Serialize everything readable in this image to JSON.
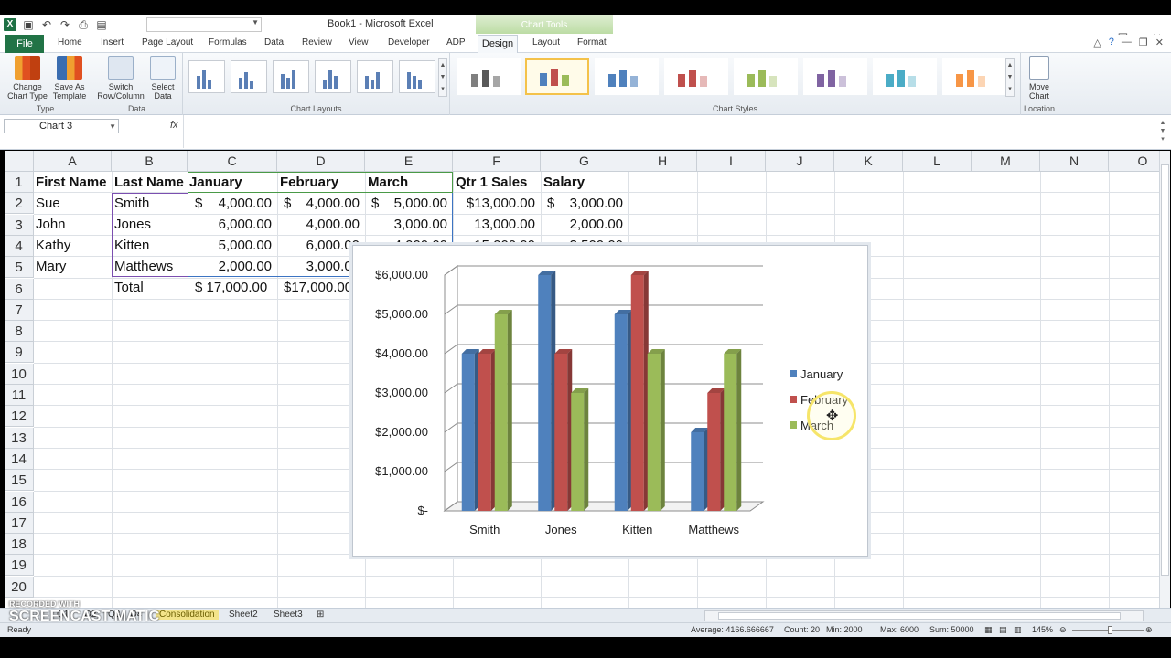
{
  "window": {
    "title": "Book1 - Microsoft Excel",
    "context_tab_group": "Chart Tools"
  },
  "tabs": [
    "File",
    "Home",
    "Insert",
    "Page Layout",
    "Formulas",
    "Data",
    "Review",
    "View",
    "Developer",
    "ADP",
    "Design",
    "Layout",
    "Format"
  ],
  "ribbon": {
    "type_group": {
      "label": "Type",
      "change_chart_type": "Change Chart Type",
      "save_as_template": "Save As Template"
    },
    "data_group": {
      "label": "Data",
      "switch_row_column": "Switch Row/Column",
      "select_data": "Select Data"
    },
    "chart_layouts_label": "Chart Layouts",
    "chart_styles_label": "Chart Styles",
    "location_group": {
      "label": "Location",
      "move_chart": "Move Chart"
    }
  },
  "formula_bar": {
    "name_box": "Chart 3",
    "fx": "fx",
    "content": ""
  },
  "columns": [
    "A",
    "B",
    "C",
    "D",
    "E",
    "F",
    "G",
    "H",
    "I",
    "J",
    "K",
    "L",
    "M",
    "N",
    "O"
  ],
  "rows": [
    "1",
    "2",
    "3",
    "4",
    "5",
    "6",
    "7",
    "8",
    "9",
    "10",
    "11",
    "12",
    "13",
    "14",
    "15",
    "16",
    "17",
    "18",
    "19",
    "20"
  ],
  "cells": {
    "r1": [
      "First Name",
      "Last Name",
      "January",
      "February",
      "March",
      "Qtr 1 Sales",
      "Salary"
    ],
    "r2": [
      "Sue",
      "Smith",
      "$",
      "4,000.00",
      "$",
      "4,000.00",
      "$",
      "5,000.00",
      "$13,000.00",
      "$",
      "3,000.00"
    ],
    "r3": [
      "John",
      "Jones",
      "6,000.00",
      "4,000.00",
      "3,000.00",
      "13,000.00",
      "2,000.00"
    ],
    "r4": [
      "Kathy",
      "Kitten",
      "5,000.00",
      "6,000.00",
      "4,000.00",
      "15,000.00",
      "3,500.00"
    ],
    "r5": [
      "Mary",
      "Matthews",
      "2,000.00",
      "3,000.00"
    ],
    "r6": [
      "Total",
      "$ 17,000.00",
      "$17,000.00"
    ]
  },
  "chart_data": {
    "type": "bar",
    "subtype": "3d-clustered-column",
    "categories": [
      "Smith",
      "Jones",
      "Kitten",
      "Matthews"
    ],
    "series": [
      {
        "name": "January",
        "values": [
          4000,
          6000,
          5000,
          2000
        ],
        "color": "#4f81bd"
      },
      {
        "name": "February",
        "values": [
          4000,
          4000,
          6000,
          3000
        ],
        "color": "#c0504d"
      },
      {
        "name": "March",
        "values": [
          5000,
          3000,
          4000,
          4000
        ],
        "color": "#9bbb59"
      }
    ],
    "y_ticks": [
      "$6,000.00",
      "$5,000.00",
      "$4,000.00",
      "$3,000.00",
      "$2,000.00",
      "$1,000.00",
      "$-"
    ],
    "ylim": [
      0,
      6000
    ],
    "grid": true,
    "legend_position": "right"
  },
  "sheet_tabs": [
    "Q1",
    "Q2",
    "Q3",
    "Q4",
    "Consolidation",
    "Sheet2",
    "Sheet3"
  ],
  "status": {
    "ready": "Ready",
    "average": "Average: 4166.666667",
    "count": "Count: 20",
    "min": "Min: 2000",
    "max": "Max: 6000",
    "sum": "Sum: 50000",
    "zoom": "145%"
  },
  "watermark": {
    "line1": "RECORDED WITH",
    "line2": "SCREENCAST",
    "line3": "MATIC"
  }
}
